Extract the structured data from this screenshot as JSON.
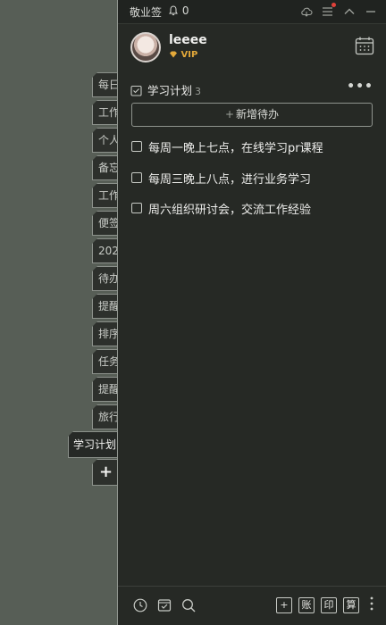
{
  "side_tabs": [
    "每日",
    "工作",
    "个人",
    "备忘",
    "工作",
    "便签",
    "202",
    "待办",
    "提醒",
    "排序",
    "任务",
    "提醒",
    "旅行"
  ],
  "active_tab": "学习计划",
  "side_add": "+",
  "titlebar": {
    "app_name": "敬业签",
    "bell_count": "0"
  },
  "profile": {
    "username": "leeee",
    "badge": "VIP"
  },
  "list": {
    "title": "学习计划",
    "count": "3",
    "new_todo": "新增待办"
  },
  "todos": [
    {
      "text": "每周一晚上七点，在线学习pr课程"
    },
    {
      "text": "每周三晚上八点，进行业务学习"
    },
    {
      "text": "周六组织研讨会，交流工作经验"
    }
  ],
  "footer": {
    "add": "+",
    "ledger": "账",
    "print": "印",
    "calc": "算"
  },
  "colors": {
    "background": "#575e56",
    "panel": "#262925",
    "vip": "#e3a93a",
    "notification_dot": "#e0413a"
  }
}
